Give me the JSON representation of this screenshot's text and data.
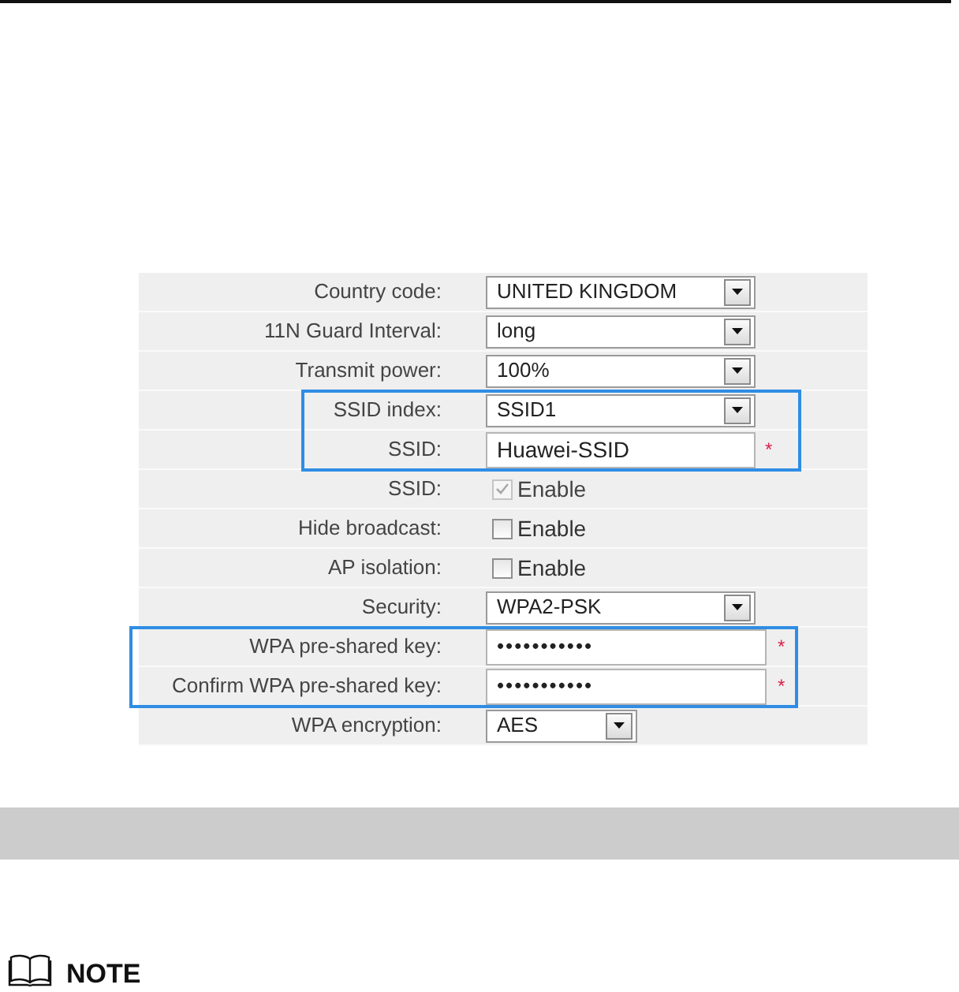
{
  "form": {
    "groups": [
      {
        "kind": "plain",
        "rows": [
          {
            "kind": "select",
            "label": "Country code:",
            "value": "UNITED KINGDOM"
          },
          {
            "kind": "select",
            "label": "11N Guard Interval:",
            "value": "long"
          },
          {
            "kind": "select",
            "label": "Transmit power:",
            "value": "100%"
          }
        ]
      },
      {
        "kind": "framed",
        "rows": [
          {
            "kind": "select",
            "label": "SSID index:",
            "value": "SSID1"
          },
          {
            "kind": "text",
            "label": "SSID:",
            "value": "Huawei-SSID",
            "required_mark": "*"
          }
        ]
      },
      {
        "kind": "plain",
        "rows": [
          {
            "kind": "checkbox",
            "label": "SSID:",
            "option": "Enable",
            "checked": true,
            "disabled": true
          },
          {
            "kind": "checkbox",
            "label": "Hide broadcast:",
            "option": "Enable",
            "checked": false,
            "disabled": false
          },
          {
            "kind": "checkbox",
            "label": "AP isolation:",
            "option": "Enable",
            "checked": false,
            "disabled": false
          },
          {
            "kind": "select",
            "label": "Security:",
            "value": "WPA2-PSK"
          }
        ]
      },
      {
        "kind": "framed",
        "rows": [
          {
            "kind": "password",
            "label": "WPA pre-shared key:",
            "value": "•••••••••••",
            "required_mark": "*"
          },
          {
            "kind": "password",
            "label": "Confirm WPA pre-shared key:",
            "value": "•••••••••••",
            "required_mark": "*"
          }
        ]
      },
      {
        "kind": "plain",
        "rows": [
          {
            "kind": "short_select",
            "label": "WPA encryption:",
            "value": "AES"
          }
        ]
      }
    ]
  },
  "note": {
    "title": "NOTE"
  }
}
